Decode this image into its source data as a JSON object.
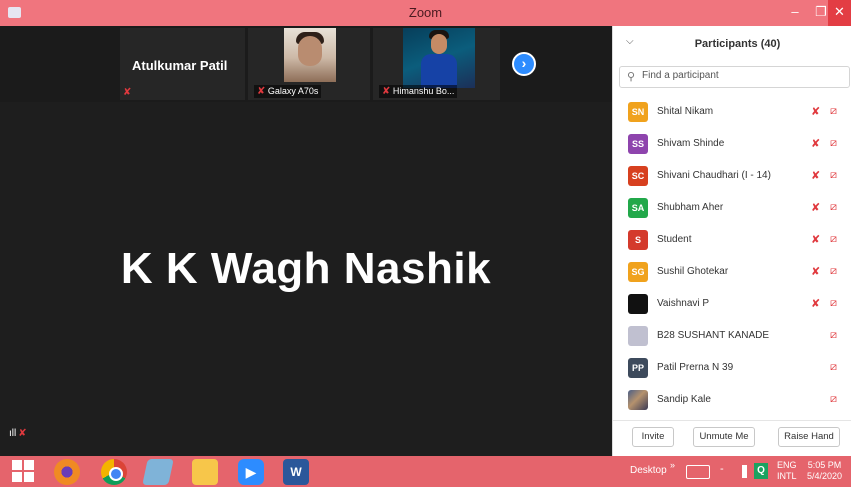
{
  "window": {
    "title": "Zoom",
    "minimize": "–",
    "maximize": "❐",
    "close": "✕"
  },
  "strip": {
    "tiles": [
      {
        "name": "Atulkumar Patil",
        "caption": ""
      },
      {
        "name": "",
        "caption": "Galaxy A70s"
      },
      {
        "name": "",
        "caption": "Himanshu Bo..."
      }
    ],
    "next_icon": "›"
  },
  "main": {
    "speaker_name": "K K Wagh Nashik",
    "signal_icon": "ıll"
  },
  "participants": {
    "title": "Participants (40)",
    "search_placeholder": "Find a participant",
    "list": [
      {
        "initials": "SN",
        "name": "Shital Nikam",
        "color": "#f0a21d",
        "muted": true,
        "video_off": true
      },
      {
        "initials": "SS",
        "name": "Shivam Shinde",
        "color": "#8e44ad",
        "muted": true,
        "video_off": true
      },
      {
        "initials": "SC",
        "name": "Shivani Chaudhari (I - 14)",
        "color": "#d7401f",
        "muted": true,
        "video_off": true
      },
      {
        "initials": "SA",
        "name": "Shubham Aher",
        "color": "#22a84a",
        "muted": true,
        "video_off": true
      },
      {
        "initials": "S",
        "name": "Student",
        "color": "#d43a2c",
        "muted": true,
        "video_off": true
      },
      {
        "initials": "SG",
        "name": "Sushil Ghotekar",
        "color": "#f0a21d",
        "muted": true,
        "video_off": true
      },
      {
        "initials": "",
        "name": "Vaishnavi P",
        "color": "#111111",
        "muted": true,
        "video_off": true
      },
      {
        "initials": "",
        "name": "B28 SUSHANT KANADE",
        "color": "#c0c0d0",
        "muted": false,
        "video_off": true
      },
      {
        "initials": "PP",
        "name": "Patil Prerna N 39",
        "color": "#3d4a5c",
        "muted": false,
        "video_off": true
      },
      {
        "initials": "",
        "name": "Sandip Kale",
        "color": "photo",
        "muted": false,
        "video_off": true
      }
    ],
    "footer": {
      "invite": "Invite",
      "unmute": "Unmute Me",
      "raise_hand": "Raise Hand"
    }
  },
  "taskbar": {
    "desktop_label": "Desktop",
    "chevron": "»",
    "word_label": "W",
    "q_label": "Q",
    "lang_top": "ENG",
    "lang_bottom": "INTL",
    "time": "5:05 PM",
    "date": "5/4/2020"
  },
  "colors": {
    "title_bar": "#f0757e",
    "taskbar": "#e5646c",
    "video_bg": "#1e1e1e",
    "accent": "#2d8cff",
    "muted_red": "#e0393e"
  }
}
